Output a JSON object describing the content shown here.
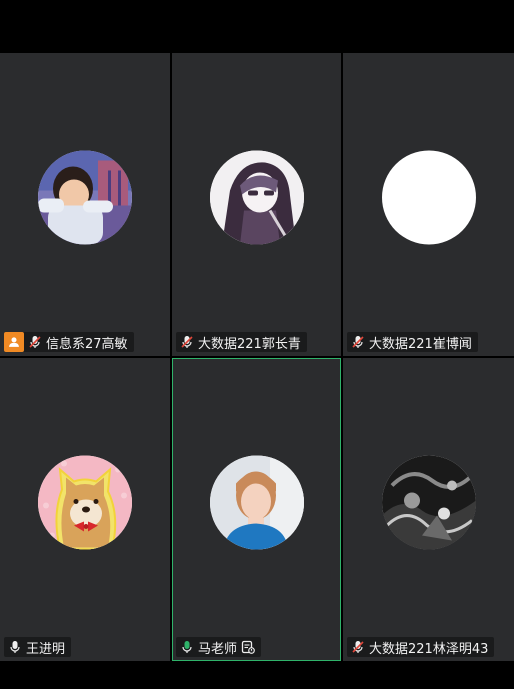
{
  "participants": [
    {
      "name": "信息系27高敏",
      "mic": "muted",
      "host": true,
      "avatar": "child-photo-avatar"
    },
    {
      "name": "大数据221郭长青",
      "mic": "muted",
      "host": false,
      "avatar": "anime-hoodie-avatar"
    },
    {
      "name": "大数据221崔博闻",
      "mic": "muted",
      "host": false,
      "avatar": "blank-white-avatar"
    },
    {
      "name": "王进明",
      "mic": "on",
      "host": false,
      "avatar": "shiba-dog-avatar"
    },
    {
      "name": "马老师",
      "mic": "speaking",
      "host": false,
      "active_speaker": true,
      "screen_share_icon": true,
      "avatar": "teacher-photo-avatar"
    },
    {
      "name": "大数据221林泽明43",
      "mic": "muted",
      "host": false,
      "avatar": "monochrome-abstract-avatar"
    }
  ],
  "colors": {
    "tile_bg": "#2b2c2e",
    "active_border": "#2fb36a",
    "host_badge": "#f08a24",
    "mic_speaking": "#2fb36a",
    "mic_muted_slash": "#e0463a"
  }
}
